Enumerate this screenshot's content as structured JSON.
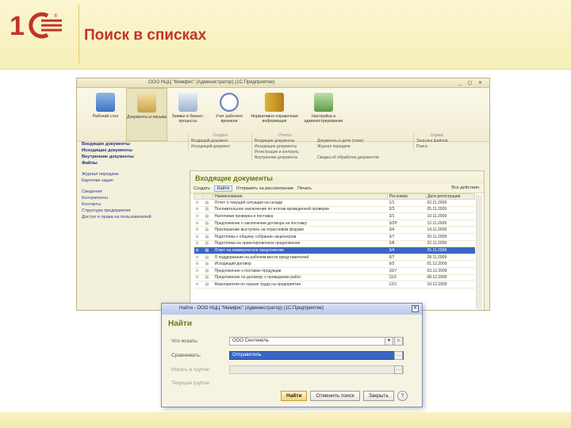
{
  "slide": {
    "logo_text": "1С",
    "title": "Поиск в списках",
    "colors": {
      "title": "#c0342a",
      "logo": "#c0342a"
    }
  },
  "app": {
    "title": "ООО НЦЦ \"Мемфис\" (Администратор) (1С:Предприятие)",
    "sections": [
      {
        "label": "Рабочий стол",
        "icon": "desktop-icon"
      },
      {
        "label": "Документы и письма",
        "icon": "documents-icon"
      },
      {
        "label": "Заявки и бизнес-процессы",
        "icon": "tasks-icon"
      },
      {
        "label": "Учет рабочего времени",
        "icon": "clock-icon"
      },
      {
        "label": "Нормативно-справочная информация",
        "icon": "books-icon"
      },
      {
        "label": "Настройка и администрирование",
        "icon": "settings-icon"
      }
    ],
    "leftnav": {
      "bold_items": [
        "Входящие документы",
        "Исходящие документы",
        "Внутренние документы",
        "Файлы"
      ],
      "items_group2": [
        "Журнал передачи",
        "Карточки задач"
      ],
      "items_group3": [
        "Сведения",
        "Контрагенты",
        "Контакты",
        "Структура предприятия",
        "Доступ и права на пользователей"
      ]
    },
    "actions": {
      "col1": {
        "header": "Создать",
        "items": [
          "Входящий документ",
          "Исходящий документ"
        ]
      },
      "col2": {
        "header": "Отчеты",
        "items": [
          "Входящие документы",
          "Исходящие документы",
          "Регистрация и контроль",
          "Внутренние документы"
        ]
      },
      "col3": {
        "header": "",
        "items": [
          "Документы в деле (томе)",
          "Журнал передачи",
          "",
          "Сводка об обработке документов"
        ]
      },
      "col4": {
        "header": "Сервис",
        "items": [
          "Загрузка файлов",
          "Поиск"
        ]
      }
    },
    "list": {
      "title": "Входящие документы",
      "toolbar": {
        "create": "Создать",
        "find": "Найти",
        "set_status": "Отправить на рассмотрение",
        "print": "Печать",
        "all_actions": "Все действия"
      },
      "columns": [
        "",
        "",
        "Наименование",
        "Рег.номер",
        "Дата регистрации"
      ],
      "rows": [
        {
          "name": "Отчет о текущей ситуации на складе",
          "num": "1/1",
          "date": "02.11.2009"
        },
        {
          "name": "Положительное заключение по итогам проведенной проверки",
          "num": "2/3",
          "date": "05.11.2009"
        },
        {
          "name": "Налоговая проверка и поставка",
          "num": "3/1",
          "date": "10.11.2009"
        },
        {
          "name": "Предложение о заключении договора на поставку",
          "num": "3/2Р",
          "date": "12.11.2009"
        },
        {
          "name": "Приглашение выступить на отраслевом форуме",
          "num": "3/4",
          "date": "14.11.2009"
        },
        {
          "name": "Подготовка к общему собранию акционеров",
          "num": "3/7",
          "date": "20.11.2009"
        },
        {
          "name": "Подготовка на ориентировочное предложение",
          "num": "3/8",
          "date": "22.11.2009"
        },
        {
          "name": "Ответ на коммерческое предложение",
          "num": "3/4",
          "date": "25.11.2009",
          "selected": true
        },
        {
          "name": "О поддержании на рабочем месте представителей",
          "num": "6/7",
          "date": "28.11.2009"
        },
        {
          "name": "Исходящий договор",
          "num": "9/2",
          "date": "01.12.2009"
        },
        {
          "name": "Предложение о поставке продукции",
          "num": "10/7",
          "date": "03.12.2009"
        },
        {
          "name": "Предложение по договору о проведении работ",
          "num": "11/2",
          "date": "08.12.2009"
        },
        {
          "name": "Мероприятия по охране труда на предприятии",
          "num": "12/1",
          "date": "10.12.2009"
        }
      ]
    }
  },
  "dialog": {
    "title": "Найти - ООО НЦЦ \"Мемфис\" (Администратор) (1С:Предприятие)",
    "heading": "Найти",
    "labels": {
      "where": "Что искать:",
      "compare": "Сравнивать:",
      "in_group": "Искать в группе:",
      "current_group": "Текущая группа:"
    },
    "values": {
      "where": "ООО Сентинель",
      "compare": "Отправитель",
      "in_group": "",
      "current_group": ""
    },
    "buttons": {
      "find": "Найти",
      "cancel_search": "Отменить поиск",
      "close": "Закрыть",
      "help": "?"
    }
  }
}
